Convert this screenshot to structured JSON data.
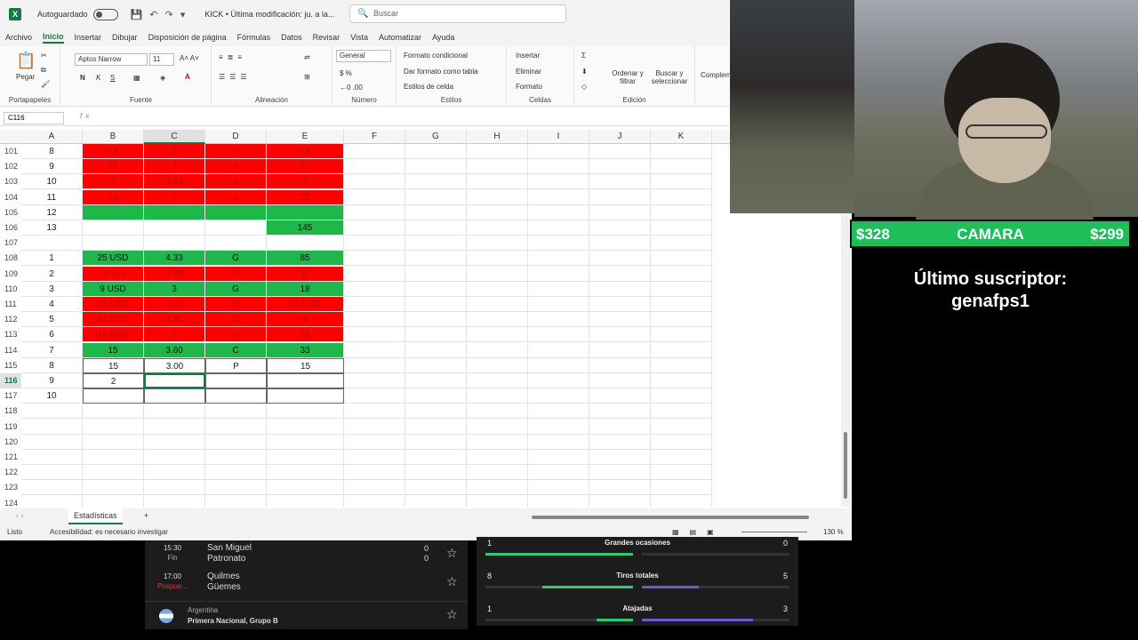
{
  "titlebar": {
    "autosave": "Autoguardado",
    "doc": "KICK • Última modificación: ju. a la...",
    "search": "Buscar"
  },
  "menu": [
    "Archivo",
    "Inicio",
    "Insertar",
    "Dibujar",
    "Disposición de página",
    "Fórmulas",
    "Datos",
    "Revisar",
    "Vista",
    "Automatizar",
    "Ayuda"
  ],
  "ribbon": {
    "paste": "Pegar",
    "clipboard": "Portapapeles",
    "font_name": "Aptos Narrow",
    "font_size": "11",
    "font": "Fuente",
    "alignment": "Alineación",
    "number_format": "General",
    "number": "Número",
    "cond_format": "Formato condicional",
    "table_format": "Dar formato como tabla",
    "cell_styles": "Estilos de celda",
    "styles": "Estilos",
    "insert": "Insertar",
    "delete": "Eliminar",
    "format": "Formato",
    "cells": "Celdas",
    "sort": "Ordenar y filtrar",
    "find": "Buscar y seleccionar",
    "editing": "Edición",
    "complements": "Complem"
  },
  "formula": {
    "cell_ref": "C116",
    "fx": "fx"
  },
  "columns": [
    "A",
    "B",
    "C",
    "D",
    "E",
    "F",
    "G",
    "H",
    "I",
    "J",
    "K"
  ],
  "rows": [
    {
      "n": "101",
      "a": "8",
      "b": "15",
      "c": "2",
      "d": "p",
      "e": "15",
      "s": "red"
    },
    {
      "n": "102",
      "a": "9",
      "b": "10",
      "c": "4",
      "d": "p",
      "e": "10",
      "s": "red"
    },
    {
      "n": "103",
      "a": "10",
      "b": "7",
      "c": "3.50",
      "d": "p",
      "e": "7",
      "s": "red"
    },
    {
      "n": "104",
      "a": "11",
      "b": "18",
      "c": "7",
      "d": "p",
      "e": "15",
      "s": "red"
    },
    {
      "n": "105",
      "a": "12",
      "b": "",
      "c": "",
      "d": "",
      "e": "",
      "s": "grn"
    },
    {
      "n": "106",
      "a": "13",
      "b": "",
      "c": "",
      "d": "",
      "e": "145",
      "s": "e-grn"
    },
    {
      "n": "107",
      "a": "",
      "b": "",
      "c": "",
      "d": "",
      "e": "",
      "s": "none"
    },
    {
      "n": "108",
      "a": "1",
      "b": "25 USD",
      "c": "4.33",
      "d": "G",
      "e": "85",
      "s": "grn"
    },
    {
      "n": "109",
      "a": "2",
      "b": "10 usd",
      "c": "3.30",
      "d": "P",
      "e": "10",
      "s": "red"
    },
    {
      "n": "110",
      "a": "3",
      "b": "9 USD",
      "c": "3",
      "d": "G",
      "e": "18",
      "s": "grn"
    },
    {
      "n": "111",
      "a": "4",
      "b": "15 USD",
      "c": "3.00",
      "d": "P",
      "e": "15 USD",
      "s": "red"
    },
    {
      "n": "112",
      "a": "5",
      "b": "14 USD",
      "c": "3.30",
      "d": "C",
      "e": "9",
      "s": "red"
    },
    {
      "n": "113",
      "a": "6",
      "b": "18 USD",
      "c": "6",
      "d": "P",
      "e": "18",
      "s": "red"
    },
    {
      "n": "114",
      "a": "7",
      "b": "15",
      "c": "3.60",
      "d": "C",
      "e": "33",
      "s": "grn"
    },
    {
      "n": "115",
      "a": "8",
      "b": "15",
      "c": "3.00",
      "d": "P",
      "e": "15",
      "s": "bd"
    },
    {
      "n": "116",
      "a": "9",
      "b": "2",
      "c": "",
      "d": "",
      "e": "",
      "s": "bd"
    },
    {
      "n": "117",
      "a": "10",
      "b": "",
      "c": "",
      "d": "",
      "e": "",
      "s": "bd"
    },
    {
      "n": "118",
      "a": "",
      "b": "",
      "c": "",
      "d": "",
      "e": "",
      "s": "none"
    },
    {
      "n": "119",
      "a": "",
      "b": "",
      "c": "",
      "d": "",
      "e": "",
      "s": "none"
    },
    {
      "n": "120",
      "a": "",
      "b": "",
      "c": "",
      "d": "",
      "e": "",
      "s": "none"
    },
    {
      "n": "121",
      "a": "",
      "b": "",
      "c": "",
      "d": "",
      "e": "",
      "s": "none"
    },
    {
      "n": "122",
      "a": "",
      "b": "",
      "c": "",
      "d": "",
      "e": "",
      "s": "none"
    },
    {
      "n": "123",
      "a": "",
      "b": "",
      "c": "",
      "d": "",
      "e": "",
      "s": "none"
    },
    {
      "n": "124",
      "a": "",
      "b": "",
      "c": "",
      "d": "",
      "e": "",
      "s": "none"
    }
  ],
  "sheet": {
    "tab": "Estadísticas",
    "add": "+"
  },
  "status": {
    "ready": "Listo",
    "accessibility": "Accesibilidad: es necesario investigar",
    "zoom": "130 %"
  },
  "overlay": {
    "left": "$328",
    "center": "CAMARA",
    "right": "$299"
  },
  "subscriber": {
    "label": "Último suscriptor:",
    "name": "genafps1"
  },
  "matches": [
    {
      "time": "15:30",
      "state": "Fin",
      "home": "San Miguel",
      "away": "Patronato",
      "hs": "0",
      "as": "0"
    },
    {
      "time": "17:00",
      "state": "Pospue...",
      "home": "Quilmes",
      "away": "Güemes",
      "hs": "",
      "as": ""
    }
  ],
  "league": {
    "country": "Argentina",
    "name": "Primera Nacional, Grupo B"
  },
  "stats": [
    {
      "label": "Grandes ocasiones",
      "l": "1",
      "r": "0",
      "lf": 1,
      "rf": 0
    },
    {
      "label": "Tiros totales",
      "l": "8",
      "r": "5",
      "lf": 0.615,
      "rf": 0.385
    },
    {
      "label": "Atajadas",
      "l": "1",
      "r": "3",
      "lf": 0.25,
      "rf": 0.75
    }
  ],
  "colors": {
    "red": "#ff0000",
    "green": "#1fb64a",
    "excel": "#107c41",
    "overlay": "#1fbe5a"
  }
}
